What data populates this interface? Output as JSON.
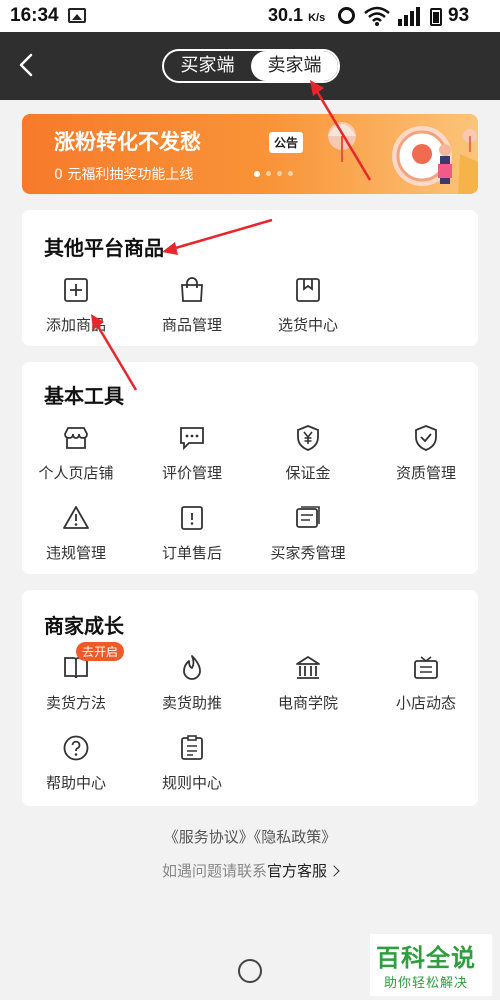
{
  "status_bar": {
    "time": "16:34",
    "speed": "30.1",
    "speed_unit": "K/s",
    "battery": "93"
  },
  "header": {
    "tabs": [
      {
        "label": "买家端",
        "active": false
      },
      {
        "label": "卖家端",
        "active": true
      }
    ]
  },
  "banner": {
    "title": "涨粉转化不发愁",
    "tag": "公告",
    "subtitle": "0 元福利抽奖功能上线",
    "slide_count": 4,
    "active_slide": 1
  },
  "sections": [
    {
      "title": "其他平台商品",
      "items": [
        {
          "label": "添加商品",
          "icon": "plus-box-icon"
        },
        {
          "label": "商品管理",
          "icon": "shopping-bag-icon"
        },
        {
          "label": "选货中心",
          "icon": "bookmark-icon"
        }
      ]
    },
    {
      "title": "基本工具",
      "items": [
        {
          "label": "个人页店铺",
          "icon": "storefront-icon"
        },
        {
          "label": "评价管理",
          "icon": "comment-icon"
        },
        {
          "label": "保证金",
          "icon": "yen-shield-icon"
        },
        {
          "label": "资质管理",
          "icon": "check-shield-icon"
        },
        {
          "label": "违规管理",
          "icon": "warning-icon"
        },
        {
          "label": "订单售后",
          "icon": "order-icon"
        },
        {
          "label": "买家秀管理",
          "icon": "message-board-icon"
        }
      ]
    },
    {
      "title": "商家成长",
      "items": [
        {
          "label": "卖货方法",
          "icon": "book-icon",
          "badge": "去开启"
        },
        {
          "label": "卖货助推",
          "icon": "fire-icon"
        },
        {
          "label": "电商学院",
          "icon": "academy-icon"
        },
        {
          "label": "小店动态",
          "icon": "news-icon"
        },
        {
          "label": "帮助中心",
          "icon": "help-icon"
        },
        {
          "label": "规则中心",
          "icon": "rules-icon"
        }
      ]
    }
  ],
  "footer": {
    "agreement": "《服务协议》",
    "privacy": "《隐私政策》",
    "contact_prefix": "如遇问题请联系",
    "contact_link": "官方客服"
  },
  "watermark": {
    "title": "百科全说",
    "subtitle": "助你轻松解决"
  },
  "colors": {
    "header_bg": "#2f2f2f",
    "banner_start": "#f77a2b",
    "badge": "#f05a28",
    "annotation_arrow": "#e8262b"
  }
}
